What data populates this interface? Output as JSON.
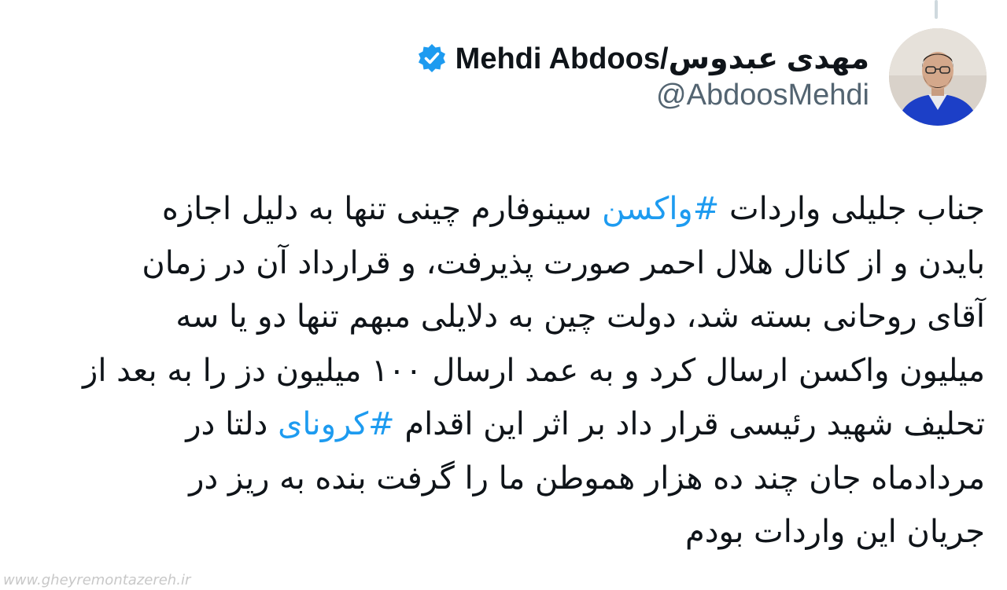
{
  "author": {
    "display_name": "مهدی عبدوس/Mehdi Abdoos",
    "handle": "@AbdoosMehdi",
    "verified": true,
    "avatar_icon": "profile-photo",
    "verified_icon": "verified-badge-icon",
    "verified_color": "#1d9bf0"
  },
  "tweet": {
    "lines": [
      {
        "before": "جناب جلیلی واردات ",
        "hashtag": "#واکسن",
        "after": " سینوفارم چینی تنها به دلیل اجازه"
      },
      {
        "before": "بایدن و از کانال هلال احمر صورت پذیرفت، و قرارداد آن در زمان",
        "hashtag": "",
        "after": ""
      },
      {
        "before": "آقای روحانی بسته شد، دولت چین به دلایلی مبهم تنها دو یا سه",
        "hashtag": "",
        "after": ""
      },
      {
        "before": "میلیون واکسن ارسال کرد و به عمد ارسال ۱۰۰ میلیون دز را به بعد از",
        "hashtag": "",
        "after": ""
      },
      {
        "before": "تحلیف شهید رئیسی قرار داد بر اثر این اقدام ",
        "hashtag": "#کرونای",
        "after": " دلتا در"
      },
      {
        "before": "مردادماه  جان چند ده هزار هموطن ما را گرفت بنده به ریز در",
        "hashtag": "",
        "after": ""
      },
      {
        "before": "جریان این واردات بودم",
        "hashtag": "",
        "after": ""
      }
    ],
    "text_color": "#0f1419",
    "hashtag_color": "#1d9bf0"
  },
  "watermark": "www.gheyremontazereh.ir"
}
